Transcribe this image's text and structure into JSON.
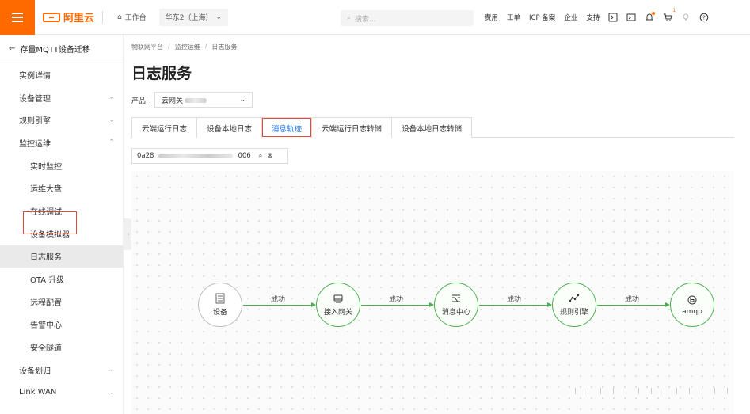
{
  "topbar": {
    "logo_text": "阿里云",
    "workbench": "工作台",
    "region": "华东2（上海）",
    "search_placeholder": "搜索...",
    "links": [
      "费用",
      "工单",
      "ICP 备案",
      "企业",
      "支持"
    ],
    "cart_badge": "1",
    "accent": "#ff6a00"
  },
  "sidebar": {
    "back_label": "存量MQTT设备迁移",
    "items": [
      {
        "label": "实例详情",
        "chevron": ""
      },
      {
        "label": "设备管理",
        "chevron": "down"
      },
      {
        "label": "规则引擎",
        "chevron": "down"
      },
      {
        "label": "监控运维",
        "chevron": "up"
      },
      {
        "label": "实时监控",
        "sub": true
      },
      {
        "label": "运维大盘",
        "sub": true
      },
      {
        "label": "在线调试",
        "sub": true
      },
      {
        "label": "设备模拟器",
        "sub": true
      },
      {
        "label": "日志服务",
        "sub": true,
        "active": true
      },
      {
        "label": "OTA 升级",
        "sub": true
      },
      {
        "label": "远程配置",
        "sub": true
      },
      {
        "label": "告警中心",
        "sub": true
      },
      {
        "label": "安全隧道",
        "sub": true
      },
      {
        "label": "设备划归",
        "chevron": "down"
      },
      {
        "label": "Link WAN",
        "chevron": "down"
      }
    ]
  },
  "main": {
    "breadcrumb": [
      "物联网平台",
      "监控运维",
      "日志服务"
    ],
    "title": "日志服务",
    "product_label": "产品:",
    "product_value": "云网关",
    "tabs": [
      "云端运行日志",
      "设备本地日志",
      "消息轨迹",
      "云端运行日志转储",
      "设备本地日志转储"
    ],
    "active_tab": "消息轨迹",
    "filter_prefix": "0a28",
    "filter_suffix": "006"
  },
  "flow": {
    "nodes": [
      {
        "label": "设备",
        "status": "pending",
        "icon": "device-icon"
      },
      {
        "label": "接入网关",
        "status": "success",
        "icon": "gateway-icon"
      },
      {
        "label": "消息中心",
        "status": "success",
        "icon": "message-center-icon"
      },
      {
        "label": "规则引擎",
        "status": "success",
        "icon": "rule-engine-icon"
      },
      {
        "label": "amqp",
        "status": "success",
        "icon": "amqp-icon"
      }
    ],
    "edges": [
      "成功",
      "成功",
      "成功",
      "成功"
    ],
    "success_color": "#4caf50",
    "pending_color": "#bdbdbd"
  }
}
